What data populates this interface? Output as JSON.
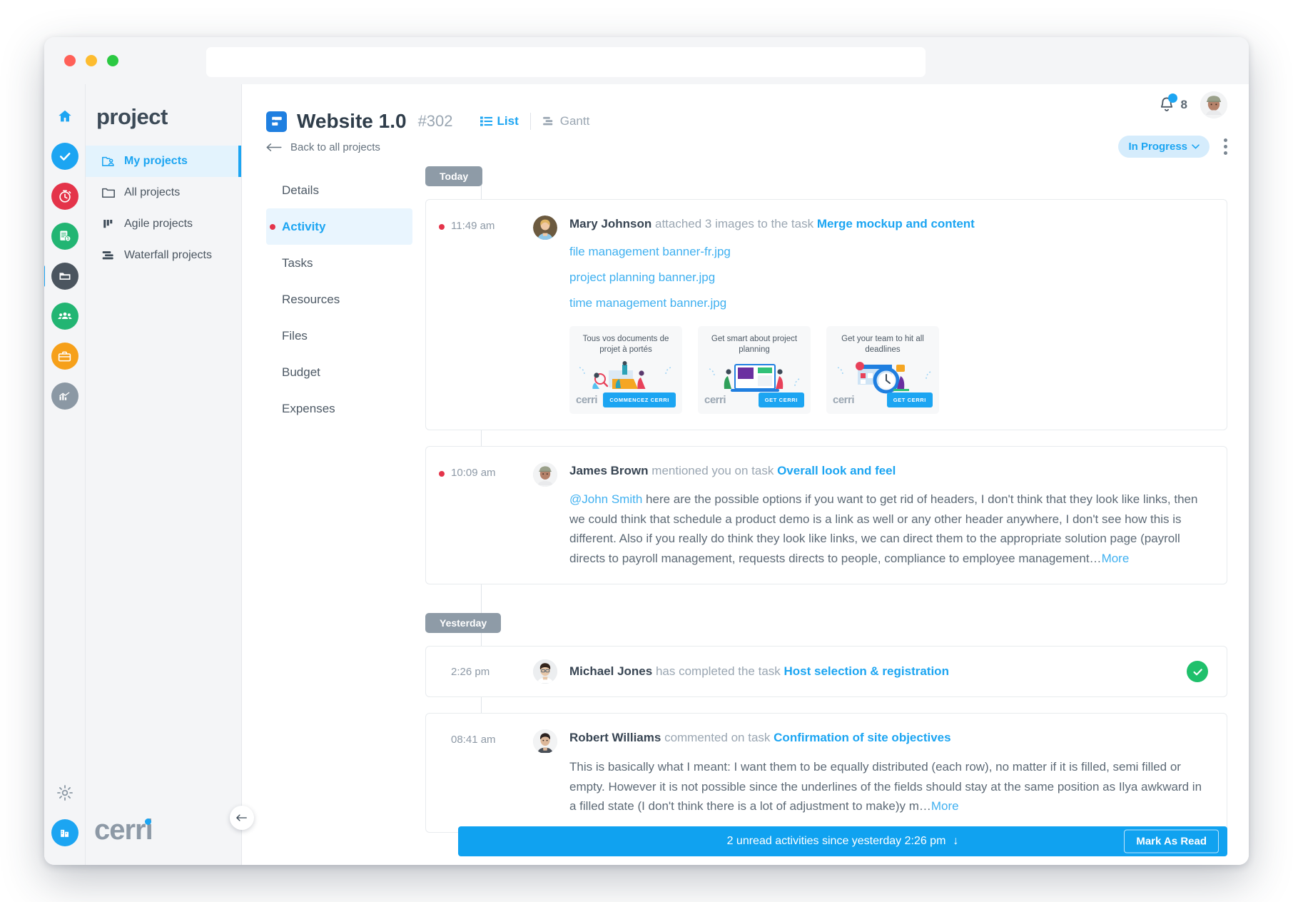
{
  "window": {
    "traffic_lights": [
      "close",
      "minimize",
      "maximize"
    ],
    "url_value": "",
    "url_placeholder": ""
  },
  "rail": {
    "items": [
      {
        "name": "home",
        "icon": "home-icon",
        "color": "transparent"
      },
      {
        "name": "tasks",
        "icon": "check-circle-icon",
        "color": "#1ca5f2"
      },
      {
        "name": "timesheet",
        "icon": "stopwatch-icon",
        "color": "#e4344a"
      },
      {
        "name": "invoices",
        "icon": "invoice-icon",
        "color": "#22b573"
      },
      {
        "name": "projects",
        "icon": "folder-icon",
        "color": "#4b555f",
        "active": true
      },
      {
        "name": "teams",
        "icon": "people-icon",
        "color": "#22b573"
      },
      {
        "name": "portfolio",
        "icon": "briefcase-icon",
        "color": "#f6a01a"
      },
      {
        "name": "reports",
        "icon": "chart-icon",
        "color": "#8b98a4"
      }
    ],
    "bottom": [
      {
        "name": "settings",
        "icon": "gear-icon",
        "color": "transparent"
      },
      {
        "name": "organization",
        "icon": "building-icon",
        "color": "#1ca5f2"
      }
    ]
  },
  "projectnav": {
    "title": "project",
    "items": [
      {
        "label": "My projects",
        "icon": "folder-user-icon",
        "active": true
      },
      {
        "label": "All projects",
        "icon": "folder-icon",
        "active": false
      },
      {
        "label": "Agile projects",
        "icon": "kanban-icon",
        "active": false
      },
      {
        "label": "Waterfall projects",
        "icon": "waterfall-icon",
        "active": false
      }
    ],
    "brand": "cerri"
  },
  "header": {
    "project_title": "Website 1.0",
    "project_number": "#302",
    "tabs": [
      {
        "label": "List",
        "icon": "list-icon",
        "active": true
      },
      {
        "label": "Gantt",
        "icon": "gantt-icon",
        "active": false
      }
    ],
    "back_label": "Back to all projects",
    "notification_count": "8",
    "status": "In Progress"
  },
  "subnav": {
    "items": [
      {
        "label": "Details",
        "active": false,
        "unread": false
      },
      {
        "label": "Activity",
        "active": true,
        "unread": true
      },
      {
        "label": "Tasks",
        "active": false,
        "unread": false
      },
      {
        "label": "Resources",
        "active": false,
        "unread": false
      },
      {
        "label": "Files",
        "active": false,
        "unread": false
      },
      {
        "label": "Budget",
        "active": false,
        "unread": false
      },
      {
        "label": "Expenses",
        "active": false,
        "unread": false
      }
    ]
  },
  "feed": {
    "day_today": "Today",
    "day_yesterday": "Yesterday",
    "entry1": {
      "time": "11:49 am",
      "author": "Mary Johnson",
      "action": "attached 3 images to the task",
      "task": "Merge mockup and content",
      "files": [
        "file management banner-fr.jpg",
        "project planning banner.jpg",
        "time management banner.jpg"
      ],
      "banners": [
        {
          "title": "Tous vos documents de projet à portés",
          "brand": "cerri",
          "cta": "COMMENCEZ CERRI"
        },
        {
          "title": "Get smart about project planning",
          "brand": "cerri",
          "cta": "GET CERRI"
        },
        {
          "title": "Get your team to hit all deadlines",
          "brand": "cerri",
          "cta": "GET CERRI"
        }
      ]
    },
    "entry2": {
      "time": "10:09 am",
      "author": "James Brown",
      "action": "mentioned you on task",
      "task": "Overall look and feel",
      "mention": "@John Smith",
      "body": " here are the possible options if you want to get rid of headers, I don't think that they look like links, then we could think that schedule a product demo is a link as well or any other header anywhere, I don't see how this is different. Also if you really do think they look like links, we can direct them to the appropriate solution page (payroll directs to payroll management, requests directs to people, compliance to employee management…",
      "more": "More"
    },
    "entry3": {
      "time": "2:26 pm",
      "author": "Michael Jones",
      "action": "has completed the task",
      "task": "Host selection & registration"
    },
    "entry4": {
      "time": "08:41 am",
      "author": "Robert Williams",
      "action": "commented on task",
      "task": "Confirmation of site objectives",
      "body": "This is basically what I meant: I want them to be equally distributed (each row), no matter if it is filled, semi filled or empty. However it is not possible since the underlines of the fields should stay at the same position as Ilya awkward in a filled state (I don't think there is a lot of adjustment to make)y m…",
      "more": "More"
    }
  },
  "unreadbar": {
    "text": "2 unread activities since yesterday 2:26 pm",
    "arrow": "↓",
    "button": "Mark As Read"
  },
  "colors": {
    "accent": "#1ca5f2",
    "red": "#e4344a",
    "green": "#1fc06b",
    "dark": "#3c4a57"
  }
}
